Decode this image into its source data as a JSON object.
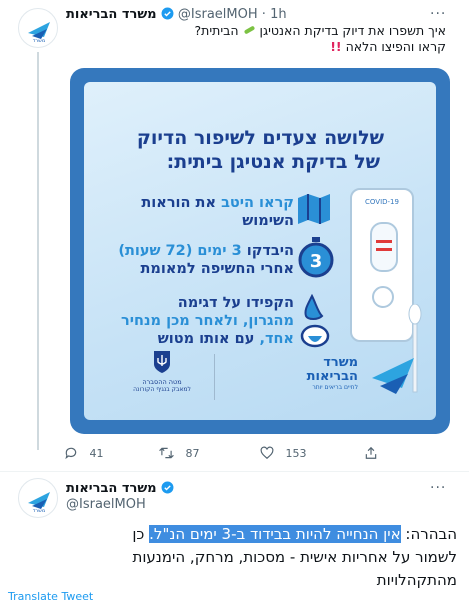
{
  "tweet1": {
    "display_name": "משרד הבריאות",
    "handle": "@IsraelMOH",
    "time": "1h",
    "more": "···",
    "text_line1": "איך תשפרו את דיוק בדיקת האנטיגן",
    "text_line1_end": "הביתית?",
    "text_line2": "קראו והפיצו הלאה",
    "text_line2_emoji": "!!"
  },
  "infographic": {
    "title_line1": "שלושה צעדים לשיפור הדיוק",
    "title_line2": "של בדיקת אנטיגן ביתית:",
    "step1_highlight": "קראו היטב",
    "step1_rest": "את הוראות",
    "step1_line2": "השימוש",
    "step2_a": "היבדקו",
    "step2_highlight": "3 ימים (72 שעות)",
    "step2_line2": "אחרי החשיפה למאומת",
    "step3_line1": "הקפידו על דגימה",
    "step3_line2_highlight": "מהגרון, ולאחר מכן מנחיר",
    "step3_line3_highlight": "אחד,",
    "step3_line3_rest": "עם אותו מטוש",
    "clock_number": "3",
    "kit_label": "COVID-19",
    "logo_left_line1": "משרד",
    "logo_left_line2": "הבריאות",
    "logo_left_small": "לחיים בריאים יותר",
    "logo_right_line1": "מטה ההסברה",
    "logo_right_line2": "למאבק בנגיף הקורונה"
  },
  "actions": {
    "replies": "41",
    "retweets": "87",
    "likes": "153"
  },
  "tweet2": {
    "display_name": "משרד הבריאות",
    "handle": "@IsraelMOH",
    "more": "···",
    "line1_prefix": "הבהרה:",
    "line1_highlight": "אין הנחייה להיות בבידוד ב-3 ימים הנ\"ל.",
    "line1_suffix": "כן",
    "line2": "לשמור על אחריות אישית  - מסכות, מרחק, הימנעות",
    "line3": "מהתקהלויות",
    "translate": "Translate Tweet"
  },
  "colors": {
    "accent": "#1d9bf0",
    "infographic_frame": "#3578bd",
    "title_dark": "#1b3f8f",
    "step_highlight": "#2a8fd6"
  }
}
